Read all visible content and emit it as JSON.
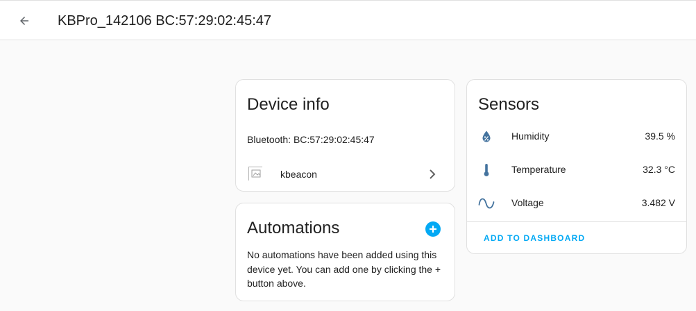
{
  "header": {
    "title": "KBPro_142106 BC:57:29:02:45:47",
    "back_icon": "arrow-left-icon"
  },
  "device_info": {
    "title": "Device info",
    "bluetooth": "Bluetooth: BC:57:29:02:45:47",
    "integration": {
      "label": "kbeacon",
      "logo_alt": "kbeacon",
      "chevron_icon": "chevron-right-icon"
    }
  },
  "automations": {
    "title": "Automations",
    "add_icon": "plus-circle-icon",
    "empty_text": "No automations have been added using this device yet. You can add one by clicking the + button above."
  },
  "sensors": {
    "title": "Sensors",
    "items": [
      {
        "name": "Humidity",
        "value": "39.5 %",
        "icon": "water-percent-icon"
      },
      {
        "name": "Temperature",
        "value": "32.3 °C",
        "icon": "thermometer-icon"
      },
      {
        "name": "Voltage",
        "value": "3.482 V",
        "icon": "sine-wave-icon"
      }
    ],
    "add_to_dashboard": "ADD TO DASHBOARD"
  },
  "colors": {
    "accent": "#03a9f4",
    "icon": "#44739e",
    "text": "#212121",
    "background": "#fafafa",
    "card": "#ffffff"
  }
}
